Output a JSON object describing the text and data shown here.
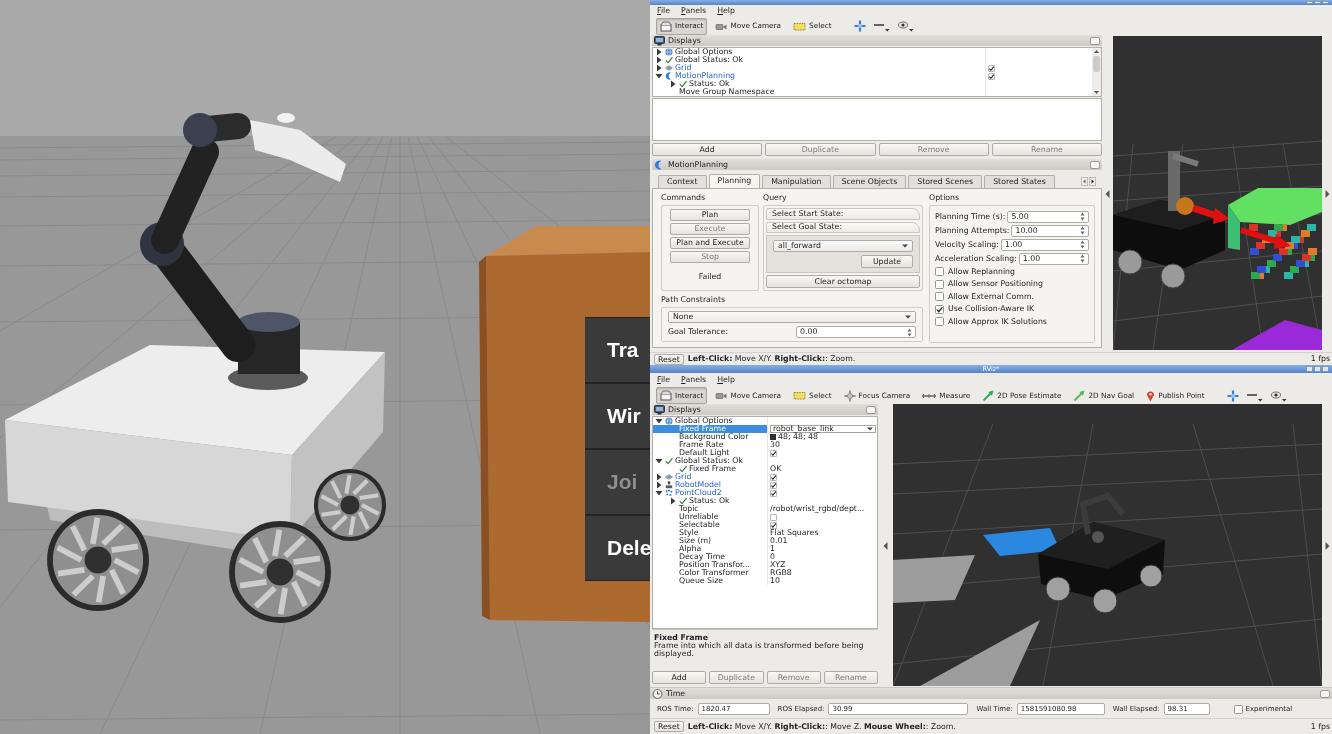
{
  "gazebo": {
    "context_menu": [
      {
        "label": "Tra",
        "disabled": false
      },
      {
        "label": "Wir",
        "disabled": false
      },
      {
        "label": "Joi",
        "disabled": true
      },
      {
        "label": "Dele",
        "disabled": false
      }
    ]
  },
  "rviz_top": {
    "menu": [
      "File",
      "Panels",
      "Help"
    ],
    "tools": [
      {
        "label": "Interact",
        "kind": "interact",
        "selected": true
      },
      {
        "label": "Move Camera",
        "kind": "move_camera",
        "selected": false
      },
      {
        "label": "Select",
        "kind": "select",
        "selected": false
      }
    ],
    "displays": {
      "title": "Displays",
      "tree": [
        {
          "label": "Global Options",
          "kind": "global_options",
          "expanded": false,
          "selected": false
        },
        {
          "label": "Global Status: Ok",
          "kind": "status",
          "expanded": false,
          "selected": false
        },
        {
          "label": "Grid",
          "kind": "grid",
          "expanded": false,
          "selected": false,
          "checked": true
        },
        {
          "label": "MotionPlanning",
          "kind": "motion_planning",
          "expanded": true,
          "selected": false,
          "checked": true,
          "children": [
            {
              "label": "Status: Ok",
              "kind": "status",
              "expanded": false,
              "selected": false
            },
            {
              "label": "Move Group Namespace",
              "kind": "property",
              "selected": false
            }
          ]
        }
      ],
      "buttons": [
        {
          "label": "Add",
          "disabled": false
        },
        {
          "label": "Duplicate",
          "disabled": true
        },
        {
          "label": "Remove",
          "disabled": true
        },
        {
          "label": "Rename",
          "disabled": true
        }
      ]
    },
    "motion_planning": {
      "title": "MotionPlanning",
      "tabs": [
        {
          "label": "Context",
          "selected": false
        },
        {
          "label": "Planning",
          "selected": true
        },
        {
          "label": "Manipulation",
          "selected": false
        },
        {
          "label": "Scene Objects",
          "selected": false
        },
        {
          "label": "Stored Scenes",
          "selected": false
        },
        {
          "label": "Stored States",
          "selected": false
        }
      ],
      "commands": {
        "title": "Commands",
        "buttons": [
          {
            "label": "Plan",
            "disabled": false
          },
          {
            "label": "Execute",
            "disabled": true
          },
          {
            "label": "Plan and Execute",
            "disabled": false
          },
          {
            "label": "Stop",
            "disabled": true
          }
        ],
        "result": "Failed"
      },
      "query": {
        "title": "Query",
        "sections": [
          "Select Start State:",
          "Select Goal State:"
        ],
        "goal": "all_forward",
        "update": "Update",
        "clear": "Clear octomap"
      },
      "options": {
        "title": "Options",
        "fields": [
          {
            "label": "Planning Time (s):",
            "value": "5.00"
          },
          {
            "label": "Planning Attempts:",
            "value": "10.00"
          },
          {
            "label": "Velocity Scaling:",
            "value": "1.00"
          },
          {
            "label": "Acceleration Scaling:",
            "value": "1.00"
          }
        ],
        "checks": [
          {
            "label": "Allow Replanning",
            "checked": false
          },
          {
            "label": "Allow Sensor Positioning",
            "checked": false
          },
          {
            "label": "Allow External Comm.",
            "checked": false
          },
          {
            "label": "Use Collision-Aware IK",
            "checked": true
          },
          {
            "label": "Allow Approx IK Solutions",
            "checked": false
          }
        ]
      },
      "path_constraints": {
        "title": "Path Constraints",
        "choice": "None",
        "tolerance_label": "Goal Tolerance:",
        "tolerance": "0.00"
      }
    },
    "status_bar": {
      "reset": "Reset",
      "hint": "**Left-Click:** Move X/Y. **Right-Click:**: Zoom.",
      "fps": "1 fps"
    }
  },
  "rviz_bottom": {
    "title": "RViz*",
    "menu": [
      "File",
      "Panels",
      "Help"
    ],
    "tools": [
      {
        "label": "Interact",
        "kind": "interact",
        "selected": true
      },
      {
        "label": "Move Camera",
        "kind": "move_camera",
        "selected": false
      },
      {
        "label": "Select",
        "kind": "select",
        "selected": false
      },
      {
        "label": "Focus Camera",
        "kind": "focus_camera",
        "selected": false
      },
      {
        "label": "Measure",
        "kind": "measure",
        "selected": false
      },
      {
        "label": "2D Pose Estimate",
        "kind": "pose_estimate",
        "selected": false
      },
      {
        "label": "2D Nav Goal",
        "kind": "nav_goal",
        "selected": false
      },
      {
        "label": "Publish Point",
        "kind": "publish_point",
        "selected": false
      }
    ],
    "displays": {
      "title": "Displays",
      "tree": [
        {
          "label": "Global Options",
          "kind": "global_options",
          "expanded": true,
          "selected": false,
          "children": [
            {
              "label": "Fixed Frame",
              "kind": "property",
              "selected": true,
              "value": "robot_base_link"
            },
            {
              "label": "Background Color",
              "kind": "property",
              "selected": false,
              "value": "48; 48; 48",
              "color": "#303030"
            },
            {
              "label": "Frame Rate",
              "kind": "property",
              "selected": false,
              "value": "30"
            },
            {
              "label": "Default Light",
              "kind": "property",
              "selected": false,
              "checked": true
            }
          ]
        },
        {
          "label": "Global Status: Ok",
          "kind": "status",
          "expanded": true,
          "selected": false,
          "children": [
            {
              "label": "Fixed Frame",
              "kind": "status",
              "selected": false,
              "value": "OK"
            }
          ]
        },
        {
          "label": "Grid",
          "kind": "grid",
          "expanded": false,
          "selected": false,
          "checked": true
        },
        {
          "label": "RobotModel",
          "kind": "robot_model",
          "expanded": false,
          "selected": false,
          "checked": true
        },
        {
          "label": "PointCloud2",
          "kind": "point_cloud",
          "expanded": true,
          "selected": false,
          "checked": true,
          "children": [
            {
              "label": "Status: Ok",
              "kind": "status",
              "expanded": false,
              "selected": false
            },
            {
              "label": "Topic",
              "kind": "property",
              "selected": false,
              "value": "/robot/wrist_rgbd/dept..."
            },
            {
              "label": "Unreliable",
              "kind": "property",
              "selected": false,
              "checked": false
            },
            {
              "label": "Selectable",
              "kind": "property",
              "selected": false,
              "checked": true
            },
            {
              "label": "Style",
              "kind": "property",
              "selected": false,
              "value": "Flat Squares"
            },
            {
              "label": "Size (m)",
              "kind": "property",
              "selected": false,
              "value": "0.01"
            },
            {
              "label": "Alpha",
              "kind": "property",
              "selected": false,
              "value": "1"
            },
            {
              "label": "Decay Time",
              "kind": "property",
              "selected": false,
              "value": "0"
            },
            {
              "label": "Position Transfor...",
              "kind": "property",
              "selected": false,
              "value": "XYZ"
            },
            {
              "label": "Color Transformer",
              "kind": "property",
              "selected": false,
              "value": "RGB8"
            },
            {
              "label": "Queue Size",
              "kind": "property",
              "selected": false,
              "value": "10"
            }
          ]
        }
      ],
      "description": {
        "title": "Fixed Frame",
        "text": "Frame into which all data is transformed before being displayed."
      },
      "buttons": [
        {
          "label": "Add",
          "disabled": false
        },
        {
          "label": "Duplicate",
          "disabled": true
        },
        {
          "label": "Remove",
          "disabled": true
        },
        {
          "label": "Rename",
          "disabled": true
        }
      ]
    },
    "time": {
      "title": "Time",
      "fields": [
        {
          "label": "ROS Time:",
          "value": "1820.47"
        },
        {
          "label": "ROS Elapsed:",
          "value": "30.99"
        },
        {
          "label": "Wall Time:",
          "value": "1581591080.98"
        },
        {
          "label": "Wall Elapsed:",
          "value": "98.31"
        }
      ],
      "experimental": {
        "label": "Experimental",
        "checked": false
      }
    },
    "status_bar": {
      "reset": "Reset",
      "hint": "**Left-Click:** Move X/Y. **Right-Click:**: Move Z. **Mouse Wheel:**: Zoom.",
      "fps": "1 fps"
    }
  }
}
